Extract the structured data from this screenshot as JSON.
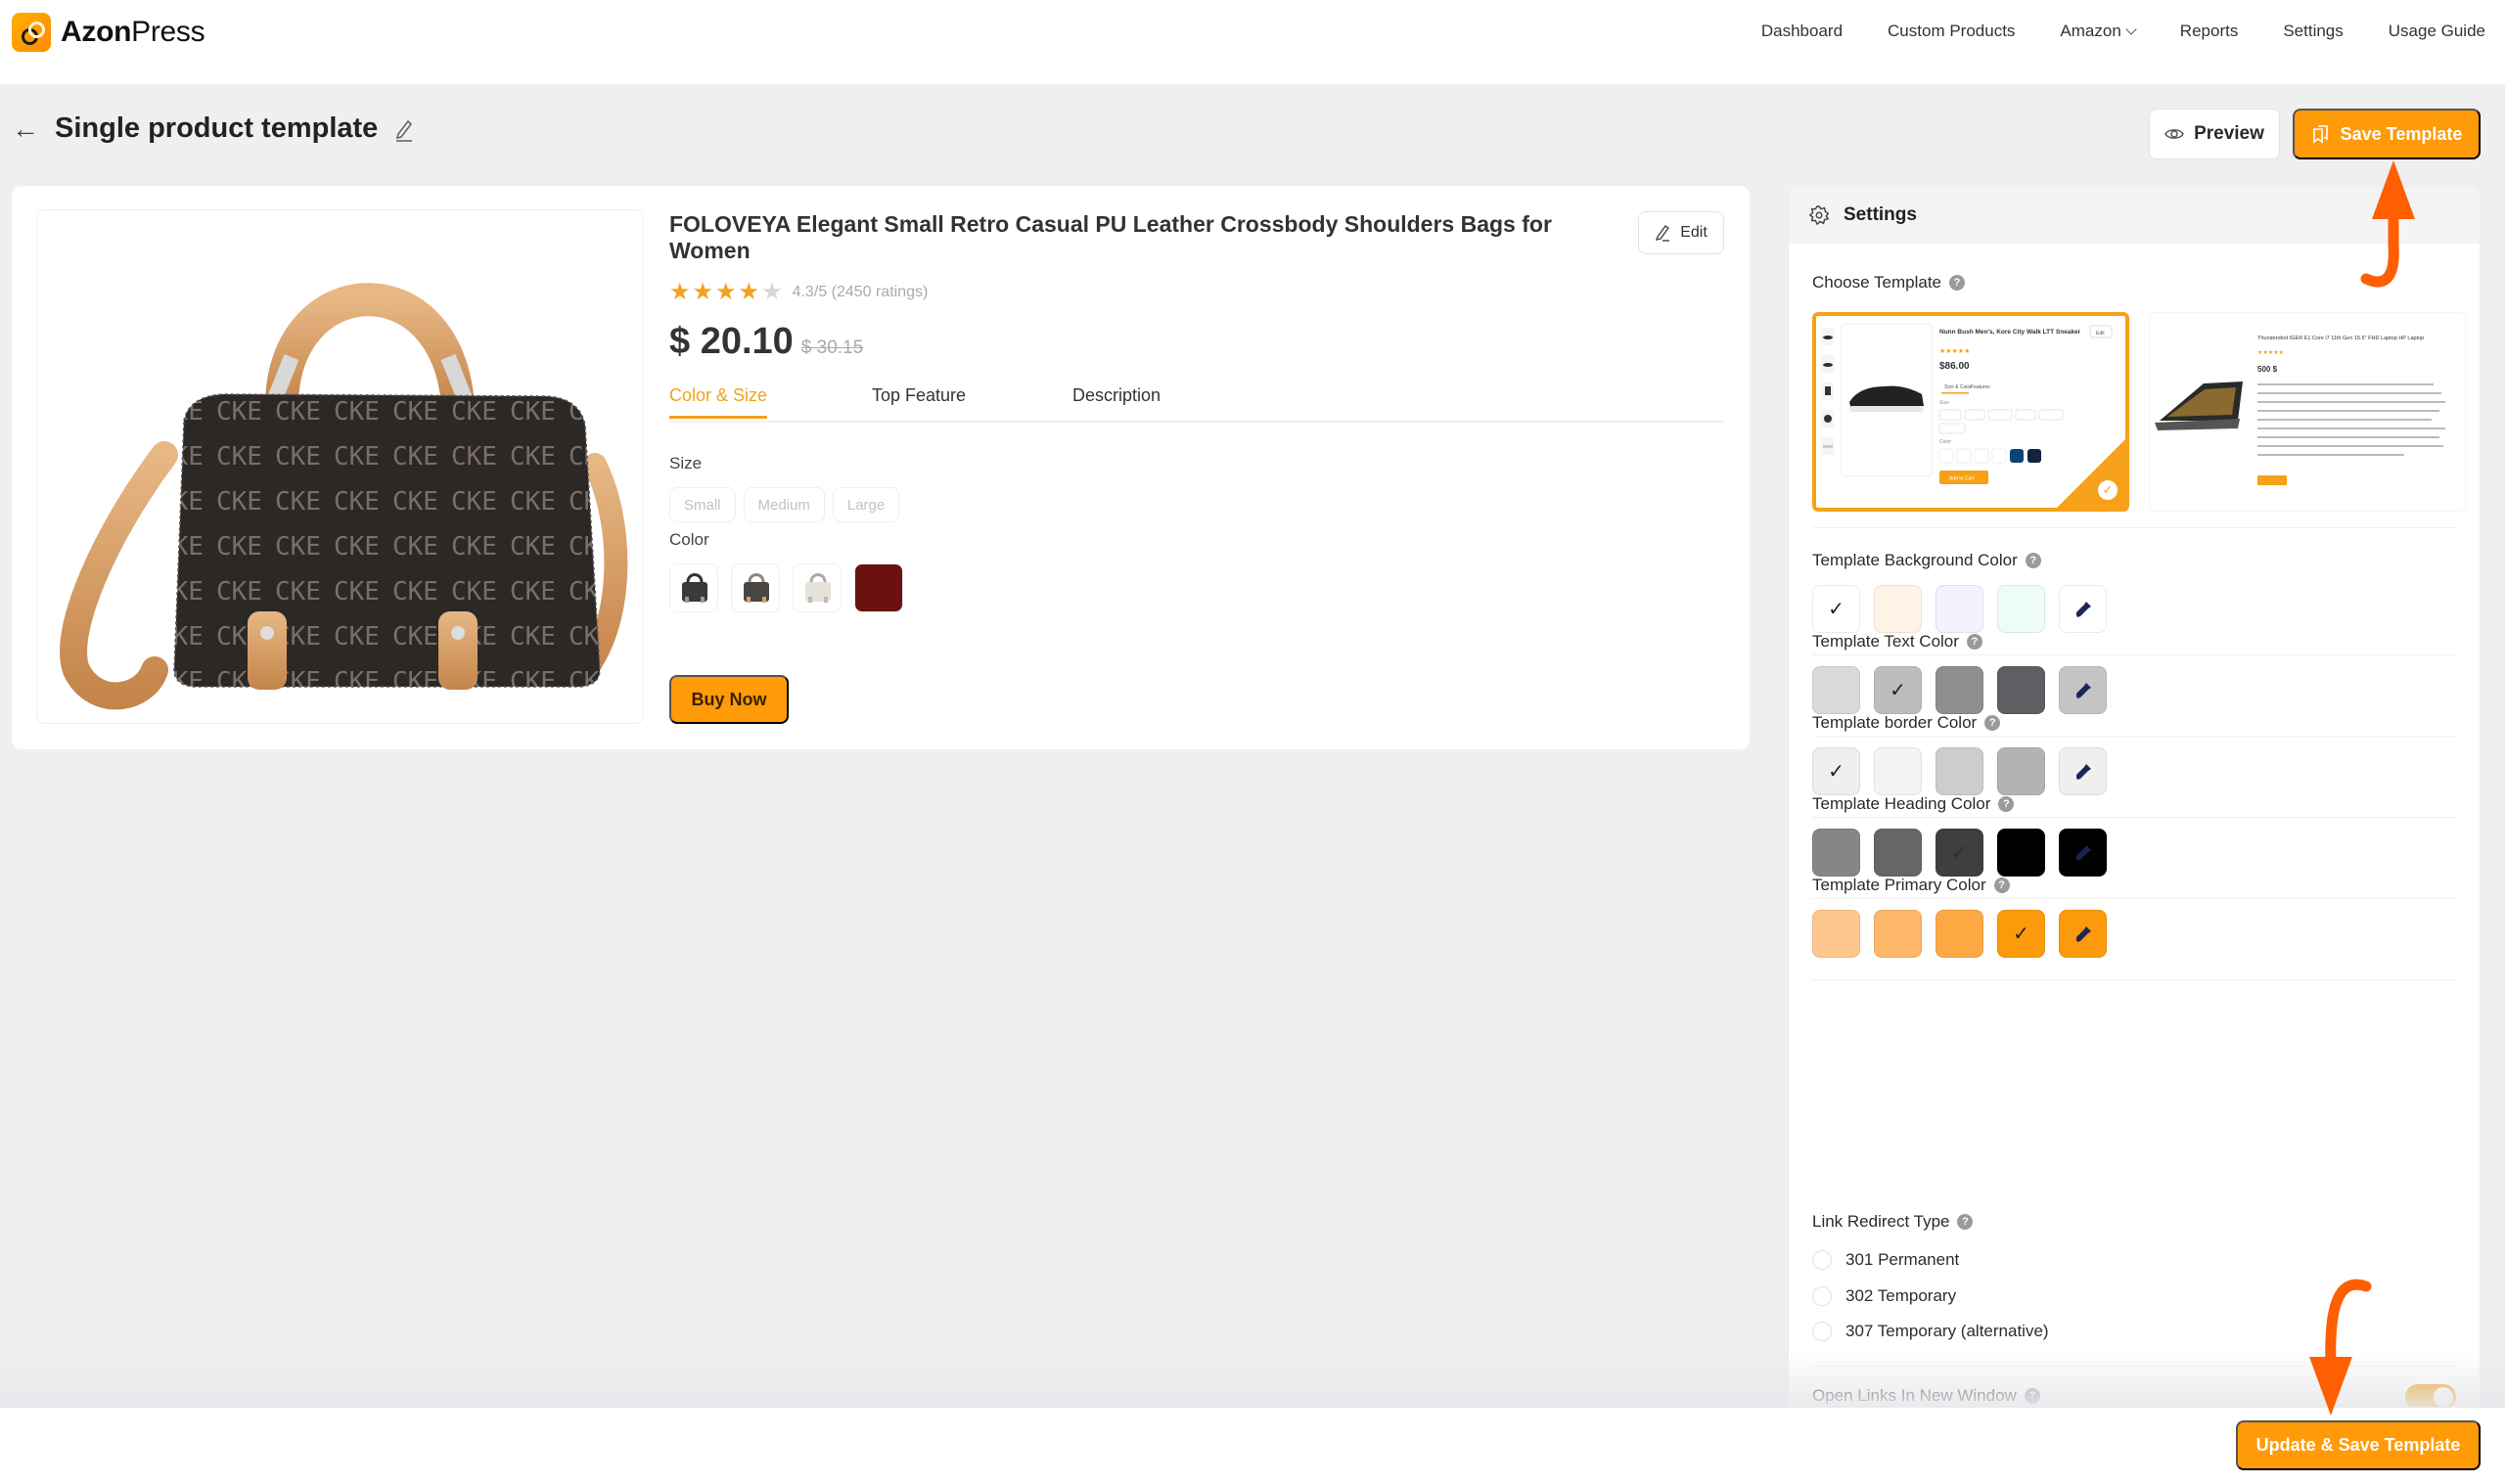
{
  "app": {
    "brand_bold": "Azon",
    "brand_light": "Press"
  },
  "nav": {
    "items": [
      {
        "label": "Dashboard"
      },
      {
        "label": "Custom Products"
      },
      {
        "label": "Amazon",
        "has_dropdown": true
      },
      {
        "label": "Reports"
      },
      {
        "label": "Settings"
      },
      {
        "label": "Usage Guide"
      }
    ]
  },
  "page": {
    "title": "Single product template",
    "preview_label": "Preview",
    "save_label": "Save Template"
  },
  "product": {
    "title": "FOLOVEYA Elegant Small Retro Casual PU Leather Crossbody Shoulders Bags for Women",
    "edit_label": "Edit",
    "rating_value": 4.3,
    "rating_max": 5,
    "rating_text": "4.3/5 (2450 ratings)",
    "price": "$ 20.10",
    "old_price": "$ 30.15",
    "tabs": [
      {
        "label": "Color & Size",
        "active": true
      },
      {
        "label": "Top Feature",
        "active": false
      },
      {
        "label": "Description",
        "active": false
      }
    ],
    "size_label": "Size",
    "sizes": [
      "Small",
      "Medium",
      "Large"
    ],
    "color_label": "Color",
    "color_options": [
      {
        "kind": "image",
        "tone": "dark"
      },
      {
        "kind": "image",
        "tone": "brown"
      },
      {
        "kind": "image",
        "tone": "light"
      },
      {
        "kind": "solid",
        "color": "#6b1210"
      }
    ],
    "buy_label": "Buy Now"
  },
  "settings": {
    "header": "Settings",
    "choose_template_label": "Choose Template",
    "templates": [
      {
        "selected": true,
        "title": "Nunn Bush Men's, Kore City Walk LTT Sneaker",
        "price": "$86.00",
        "edit": "Edit",
        "tabs": [
          "Size & Color",
          "Features"
        ],
        "size_label": "Size",
        "sizes": [
          "X-Small",
          "Small",
          "Medium",
          "Large",
          "X-Large",
          "XX-Large"
        ],
        "color_label": "Color",
        "button": "Add to Cart"
      },
      {
        "selected": false,
        "title": "Thunderobot IGER E1 Core i7 11th Gen 15.6\" FHD Laptop HP Laptop",
        "price": "500 $",
        "button": "Buy Now"
      }
    ],
    "color_groups": [
      {
        "label": "Template Background Color",
        "swatches": [
          "#ffffff",
          "#fff3e6",
          "#f3f3fd",
          "#eefcf6",
          "#ffffff"
        ],
        "selected_index": 0,
        "picker_index": 4
      },
      {
        "label": "Template Text Color",
        "swatches": [
          "#d9d9d9",
          "#bdbdbd",
          "#8e8e90",
          "#5e5f62",
          "#c4c4c6"
        ],
        "selected_index": 1,
        "picker_index": 4
      },
      {
        "label": "Template border Color",
        "swatches": [
          "#efefef",
          "#f4f4f4",
          "#cdcdcd",
          "#b3b3b3",
          "#efefef"
        ],
        "selected_index": 0,
        "picker_index": 4
      },
      {
        "label": "Template Heading Color",
        "swatches": [
          "#868686",
          "#666666",
          "#3f3f3f",
          "#000000",
          "#000000"
        ],
        "selected_index": 2,
        "picker_index": 4
      },
      {
        "label": "Template Primary Color",
        "swatches": [
          "#fdc78e",
          "#fdb769",
          "#fca944",
          "#fd9a0c",
          "#fd9a0c"
        ],
        "selected_index": 3,
        "picker_index": 4
      }
    ],
    "redirect_label": "Link Redirect Type",
    "redirect_options": [
      {
        "label": "301 Permanent",
        "checked": false
      },
      {
        "label": "302 Temporary",
        "checked": false
      },
      {
        "label": "307 Temporary (alternative)",
        "checked": false
      }
    ],
    "new_window_label": "Open Links In New Window",
    "new_window_enabled": true
  },
  "footer": {
    "update_label": "Update & Save Template"
  },
  "colors": {
    "primary": "#ff9a08",
    "annotation_arrow": "#ff5f00"
  }
}
